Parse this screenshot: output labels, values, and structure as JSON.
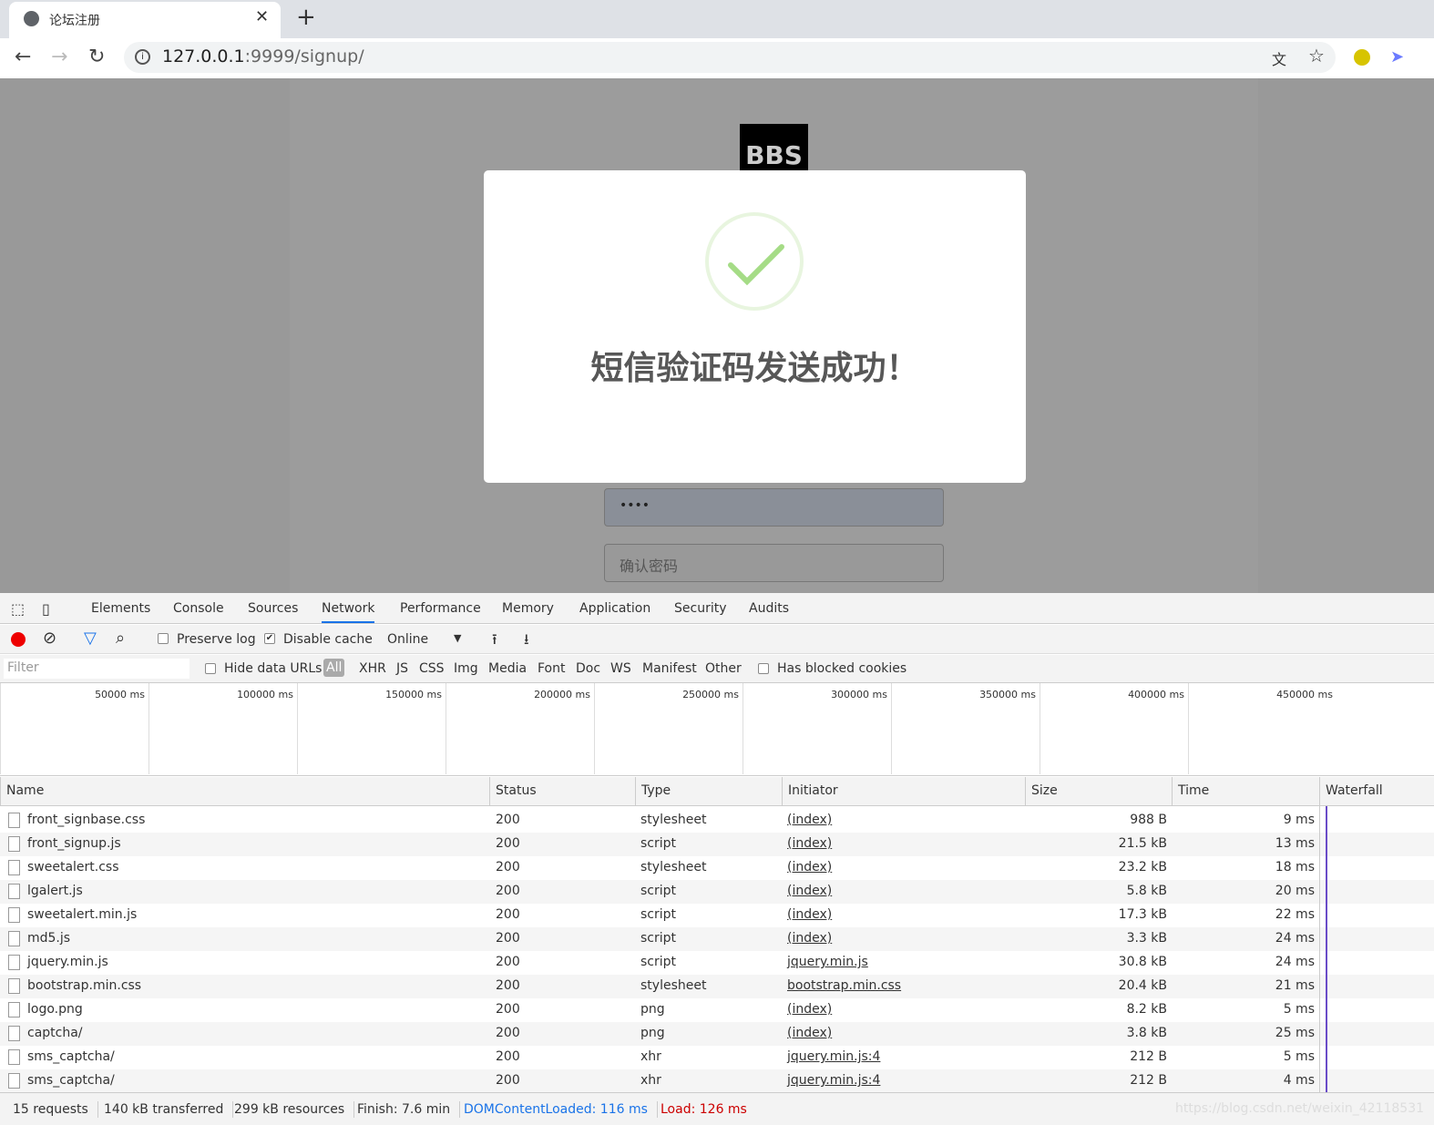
{
  "browser": {
    "tab_title": "论坛注册",
    "url_host": "127.0.0.1",
    "url_rest": ":9999/signup/"
  },
  "page": {
    "logo_text": "BBS",
    "password_value": "••••",
    "confirm_placeholder": "确认密码"
  },
  "modal": {
    "message": "短信验证码发送成功！",
    "icon": "success-check-icon",
    "accent": "#a5dc86"
  },
  "devtools": {
    "tabs": [
      "Elements",
      "Console",
      "Sources",
      "Network",
      "Performance",
      "Memory",
      "Application",
      "Security",
      "Audits"
    ],
    "active_tab": "Network",
    "preserve_log": "Preserve log",
    "disable_cache": "Disable cache",
    "throttle": "Online",
    "filter_placeholder": "Filter",
    "hide_data_urls": "Hide data URLs",
    "type_filters": [
      "All",
      "XHR",
      "JS",
      "CSS",
      "Img",
      "Media",
      "Font",
      "Doc",
      "WS",
      "Manifest",
      "Other"
    ],
    "has_blocked_cookies": "Has blocked cookies",
    "timeline_ticks": [
      "50000 ms",
      "100000 ms",
      "150000 ms",
      "200000 ms",
      "250000 ms",
      "300000 ms",
      "350000 ms",
      "400000 ms",
      "450000 ms"
    ],
    "columns": [
      "Name",
      "Status",
      "Type",
      "Initiator",
      "Size",
      "Time",
      "Waterfall"
    ],
    "rows": [
      {
        "name": "front_signbase.css",
        "status": "200",
        "type": "stylesheet",
        "initiator": "(index)",
        "size": "988 B",
        "time": "9 ms"
      },
      {
        "name": "front_signup.js",
        "status": "200",
        "type": "script",
        "initiator": "(index)",
        "size": "21.5 kB",
        "time": "13 ms"
      },
      {
        "name": "sweetalert.css",
        "status": "200",
        "type": "stylesheet",
        "initiator": "(index)",
        "size": "23.2 kB",
        "time": "18 ms"
      },
      {
        "name": "lgalert.js",
        "status": "200",
        "type": "script",
        "initiator": "(index)",
        "size": "5.8 kB",
        "time": "20 ms"
      },
      {
        "name": "sweetalert.min.js",
        "status": "200",
        "type": "script",
        "initiator": "(index)",
        "size": "17.3 kB",
        "time": "22 ms"
      },
      {
        "name": "md5.js",
        "status": "200",
        "type": "script",
        "initiator": "(index)",
        "size": "3.3 kB",
        "time": "24 ms"
      },
      {
        "name": "jquery.min.js",
        "status": "200",
        "type": "script",
        "initiator": "jquery.min.js",
        "size": "30.8 kB",
        "time": "24 ms"
      },
      {
        "name": "bootstrap.min.css",
        "status": "200",
        "type": "stylesheet",
        "initiator": "bootstrap.min.css",
        "size": "20.4 kB",
        "time": "21 ms"
      },
      {
        "name": "logo.png",
        "status": "200",
        "type": "png",
        "initiator": "(index)",
        "size": "8.2 kB",
        "time": "5 ms"
      },
      {
        "name": "captcha/",
        "status": "200",
        "type": "png",
        "initiator": "(index)",
        "size": "3.8 kB",
        "time": "25 ms"
      },
      {
        "name": "sms_captcha/",
        "status": "200",
        "type": "xhr",
        "initiator": "jquery.min.js:4",
        "size": "212 B",
        "time": "5 ms"
      },
      {
        "name": "sms_captcha/",
        "status": "200",
        "type": "xhr",
        "initiator": "jquery.min.js:4",
        "size": "212 B",
        "time": "4 ms"
      }
    ],
    "status": {
      "requests": "15 requests",
      "transferred": "140 kB transferred",
      "resources": "299 kB resources",
      "finish": "Finish: 7.6 min",
      "dcl": "DOMContentLoaded: 116 ms",
      "load": "Load: 126 ms"
    }
  },
  "watermark": "https://blog.csdn.net/weixin_42118531"
}
